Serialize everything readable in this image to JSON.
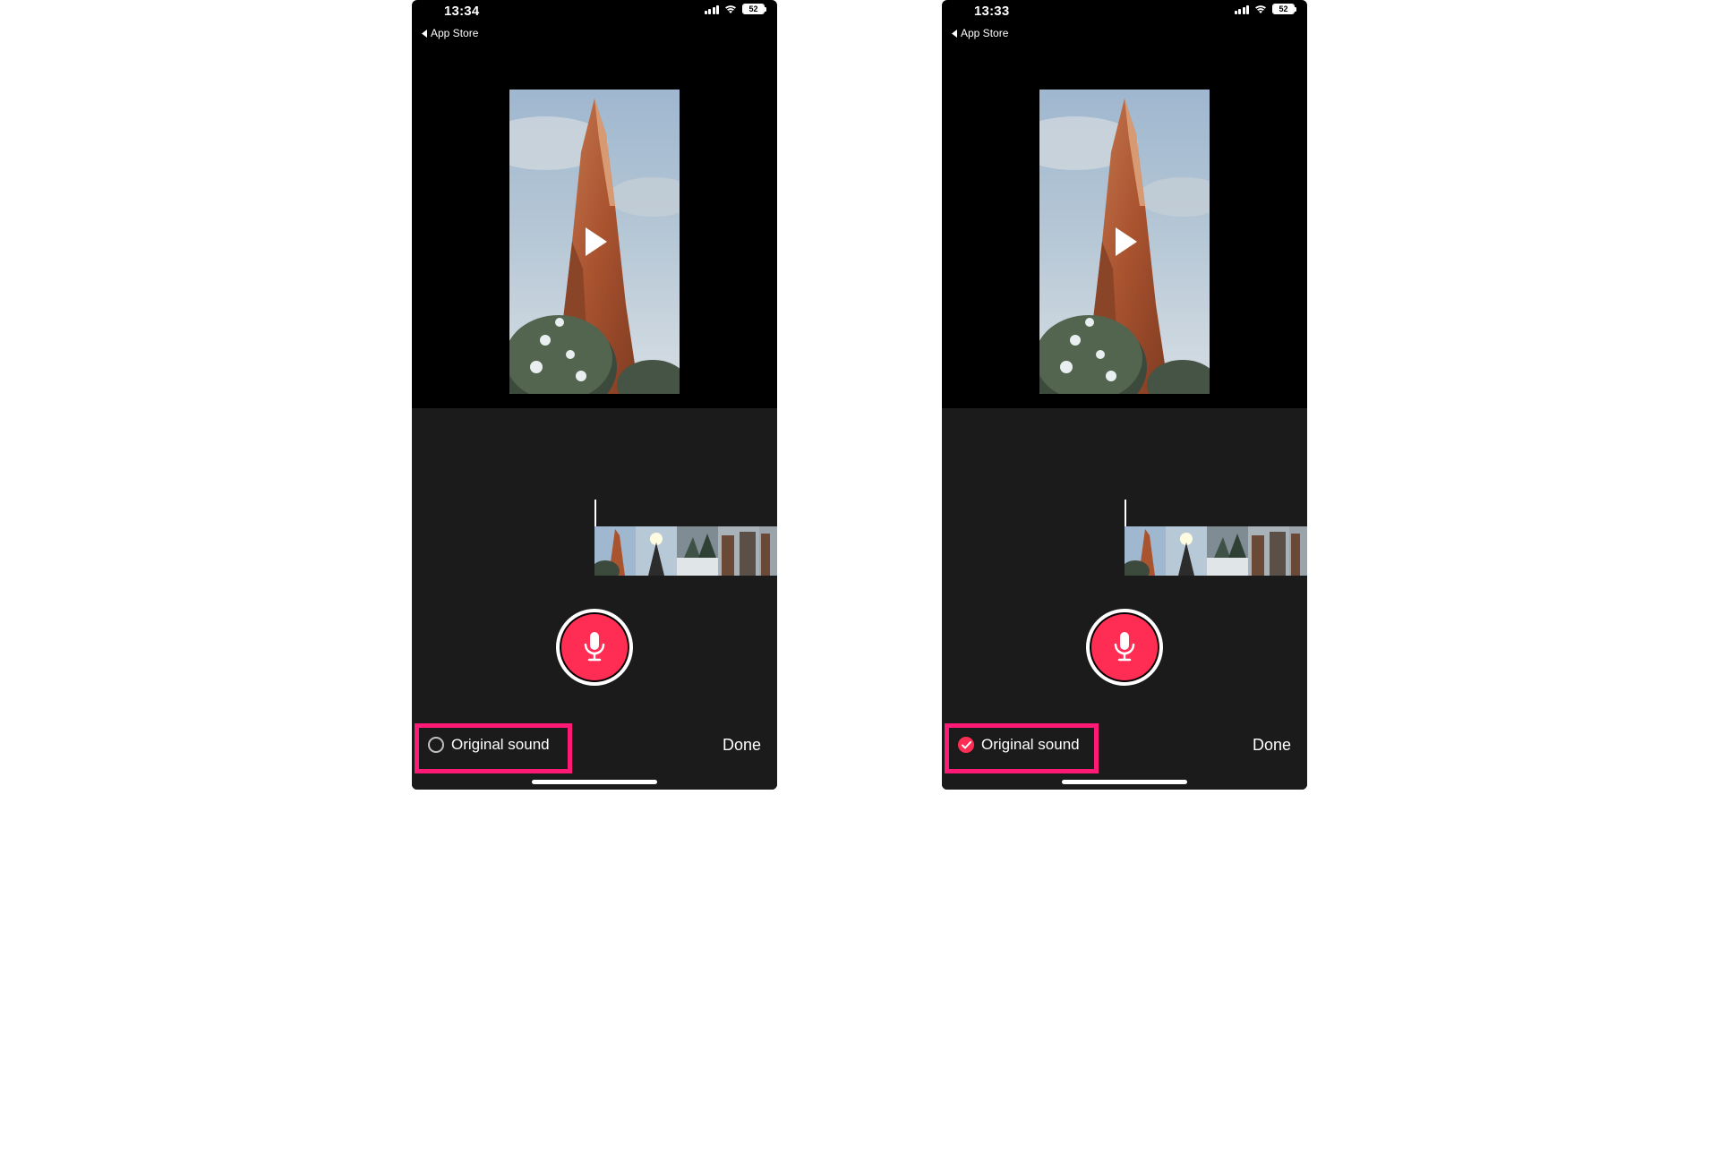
{
  "left": {
    "status_time": "13:34",
    "battery": "52",
    "back_link": "App Store",
    "original_sound": {
      "label": "Original sound",
      "checked": false
    },
    "done_label": "Done"
  },
  "right": {
    "status_time": "13:33",
    "battery": "52",
    "back_link": "App Store",
    "original_sound": {
      "label": "Original sound",
      "checked": true
    },
    "done_label": "Done"
  },
  "colors": {
    "accent": "#ff2d54",
    "highlight": "#ff1a75"
  }
}
